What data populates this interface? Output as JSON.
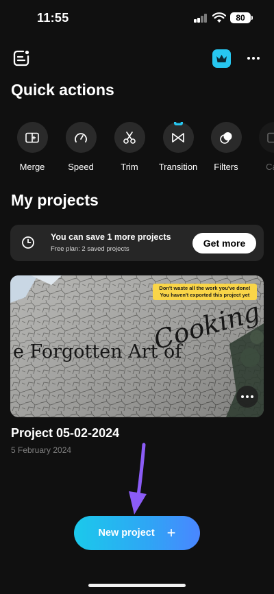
{
  "status_bar": {
    "time": "11:55",
    "battery": "80"
  },
  "top_bar": {
    "menu_icon": "menu-doc-icon",
    "premium_icon": "crown-icon",
    "more_icon": "more-dots-icon",
    "accent_color": "#27c7f0"
  },
  "quick_actions": {
    "title": "Quick actions",
    "items": [
      {
        "label": "Merge",
        "icon": "merge-icon"
      },
      {
        "label": "Speed",
        "icon": "speed-gauge-icon"
      },
      {
        "label": "Trim",
        "icon": "scissors-icon"
      },
      {
        "label": "Transition",
        "icon": "transition-icon",
        "premium": true
      },
      {
        "label": "Filters",
        "icon": "filters-icon"
      },
      {
        "label": "Cap",
        "icon": "captions-icon"
      }
    ]
  },
  "my_projects": {
    "title": "My projects",
    "plan": {
      "title": "You can save 1 more projects",
      "subtitle": "Free plan: 2 saved projects",
      "button": "Get more"
    },
    "project": {
      "warning_line1": "Don't waste all the work you've done!",
      "warning_line2": "You haven't exported this project yet",
      "thumbnail_text_1": "e Forgotten Art of",
      "thumbnail_text_2": "Cooking",
      "name": "Project 05-02-2024",
      "date": "5 February 2024"
    }
  },
  "new_project": {
    "label": "New project",
    "plus": "+"
  },
  "colors": {
    "background": "#101010",
    "card": "#262626",
    "warning": "#f9d548",
    "arrow": "#8b5cf6"
  }
}
